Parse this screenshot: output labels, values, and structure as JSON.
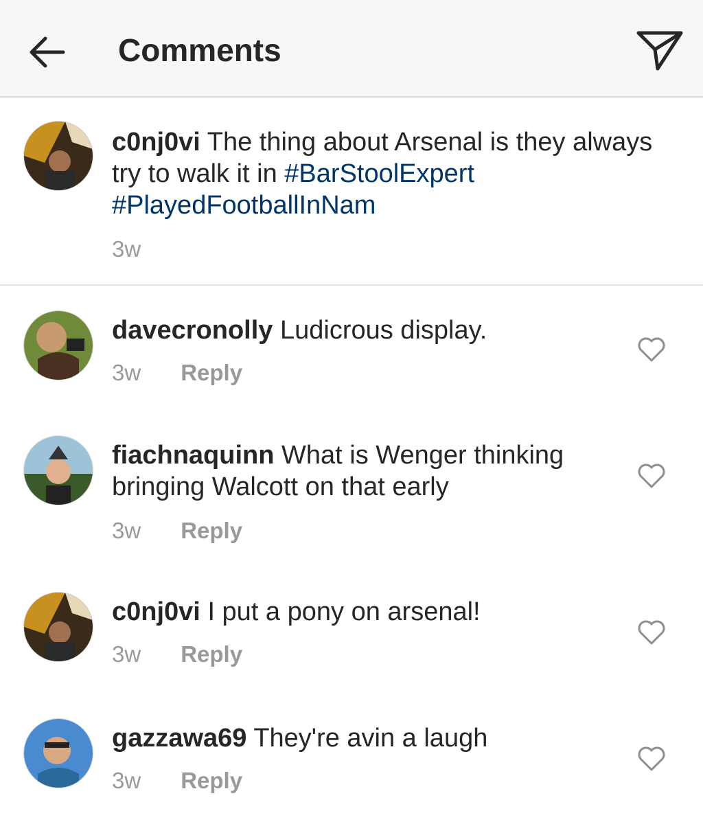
{
  "header": {
    "title": "Comments",
    "back_icon": "back-arrow-icon",
    "send_icon": "direct-send-icon"
  },
  "caption": {
    "username": "c0nj0vi",
    "text": "The thing about Arsenal is they always try to walk it in",
    "hashtags": [
      "#BarStoolExpert",
      "#PlayedFootballInNam"
    ],
    "time": "3w"
  },
  "comments": [
    {
      "username": "davecronolly",
      "text": "Ludicrous display.",
      "time": "3w",
      "reply_label": "Reply"
    },
    {
      "username": "fiachnaquinn",
      "text": "What is Wenger thinking bringing Walcott on that early",
      "time": "3w",
      "reply_label": "Reply"
    },
    {
      "username": "c0nj0vi",
      "text": "I put a pony on arsenal!",
      "time": "3w",
      "reply_label": "Reply"
    },
    {
      "username": "gazzawa69",
      "text": "They're avin a laugh",
      "time": "3w",
      "reply_label": "Reply"
    }
  ],
  "colors": {
    "hashtag": "#003569",
    "meta": "#999999",
    "header_bg": "#f7f7f7"
  }
}
